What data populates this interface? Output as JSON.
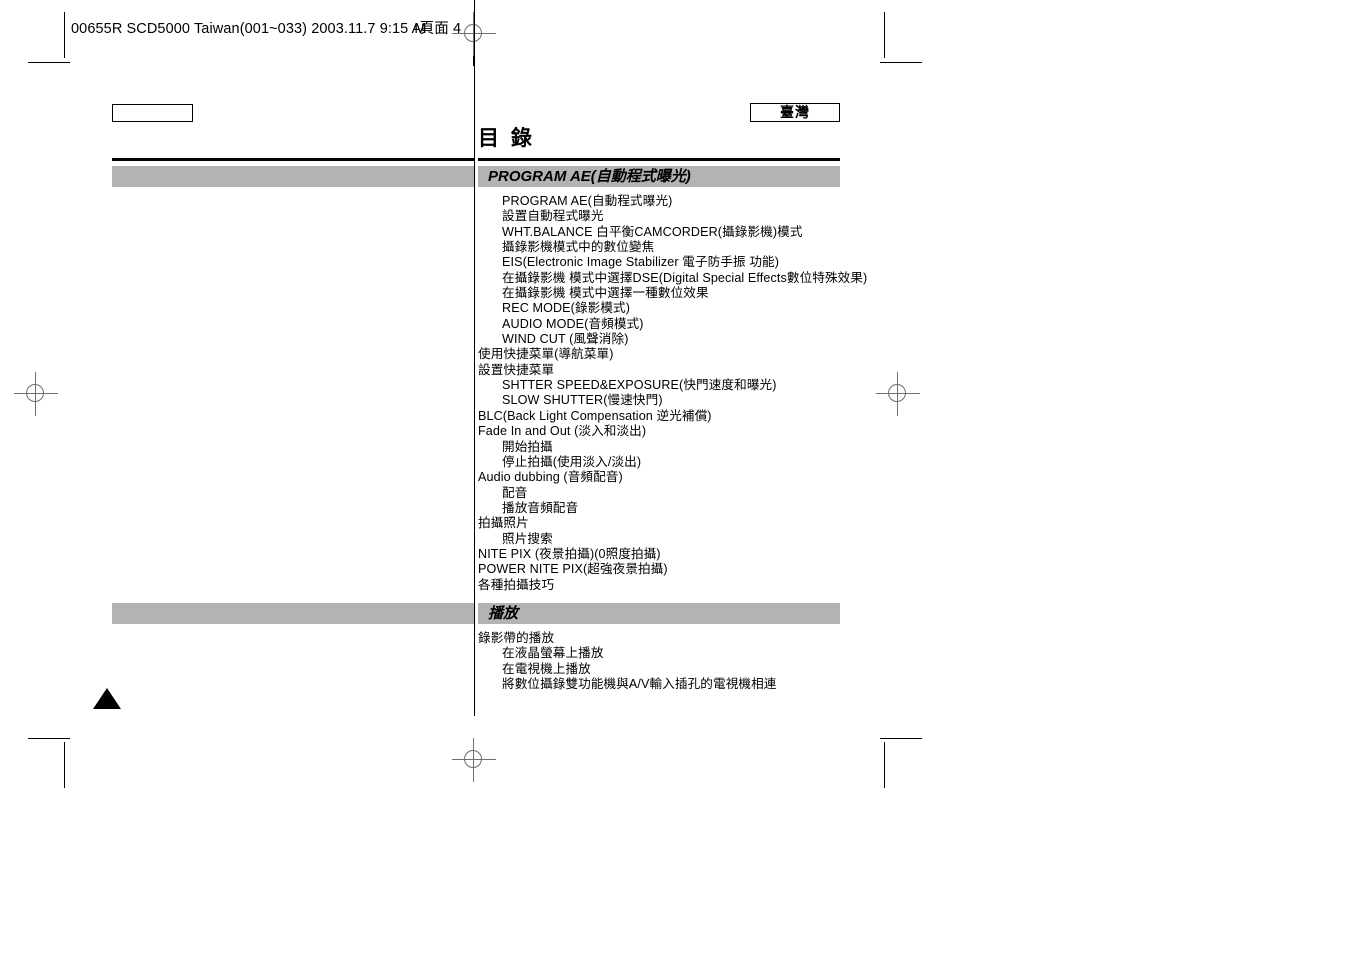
{
  "header": {
    "slug_prefix": "00655R SCD5000 Taiwan(001~033)  2003.11.7  9:15 A",
    "slug_overlap_a": "M",
    "slug_overlap_b": "頁",
    "slug_overlap_c": "面",
    "slug_page": "4"
  },
  "locale": {
    "label": "臺灣"
  },
  "toc": {
    "title": "目 錄",
    "sections": [
      {
        "band_label": "PROGRAM AE(自動程式曝光)",
        "items": [
          {
            "level": 2,
            "text": "PROGRAM AE(自動程式曝光)"
          },
          {
            "level": 2,
            "text": "設置自動程式曝光"
          },
          {
            "level": 2,
            "text": "WHT.BALANCE 白平衡CAMCORDER(攝錄影機)模式"
          },
          {
            "level": 2,
            "text": "攝錄影機模式中的數位變焦"
          },
          {
            "level": 2,
            "text": "EIS(Electronic Image Stabilizer 電子防手振 功能)"
          },
          {
            "level": 2,
            "text": "在攝錄影機 模式中選擇DSE(Digital Special Effects數位特殊效果)"
          },
          {
            "level": 2,
            "text": "在攝錄影機 模式中選擇一種數位效果"
          },
          {
            "level": 2,
            "text": "REC MODE(錄影模式)"
          },
          {
            "level": 2,
            "text": "AUDIO MODE(音頻模式)"
          },
          {
            "level": 2,
            "text": "WIND CUT (風聲消除)"
          },
          {
            "level": 1,
            "text": "使用快捷菜單(導航菜單)"
          },
          {
            "level": 1,
            "text": "設置快捷菜單"
          },
          {
            "level": 2,
            "text": "SHTTER SPEED&EXPOSURE(快門速度和曝光)"
          },
          {
            "level": 2,
            "text": "SLOW SHUTTER(慢速快門)"
          },
          {
            "level": 1,
            "text": "BLC(Back Light Compensation 逆光補償)"
          },
          {
            "level": 1,
            "text": "Fade In and Out (淡入和淡出)"
          },
          {
            "level": 2,
            "text": "開始拍攝"
          },
          {
            "level": 2,
            "text": "停止拍攝(使用淡入/淡出)"
          },
          {
            "level": 1,
            "text": "Audio dubbing (音頻配音)"
          },
          {
            "level": 2,
            "text": "配音"
          },
          {
            "level": 2,
            "text": "播放音頻配音"
          },
          {
            "level": 1,
            "text": "拍攝照片"
          },
          {
            "level": 2,
            "text": "照片搜索"
          },
          {
            "level": 1,
            "text": "NITE PIX (夜景拍攝)(0照度拍攝)"
          },
          {
            "level": 1,
            "text": "POWER NITE PIX(超強夜景拍攝)"
          },
          {
            "level": 1,
            "text": "各種拍攝技巧"
          }
        ]
      },
      {
        "band_label": "播放",
        "items": [
          {
            "level": 1,
            "text": "錄影帶的播放"
          },
          {
            "level": 2,
            "text": "在液晶螢幕上播放"
          },
          {
            "level": 2,
            "text": "在電視機上播放"
          },
          {
            "level": 2,
            "text": "將數位攝錄雙功能機與A/V輸入插孔的電視機相連"
          }
        ]
      }
    ]
  },
  "colors": {
    "band_gray": "#b3b3b3",
    "rule_black": "#000000",
    "registration_gray": "#6e6e6e"
  }
}
